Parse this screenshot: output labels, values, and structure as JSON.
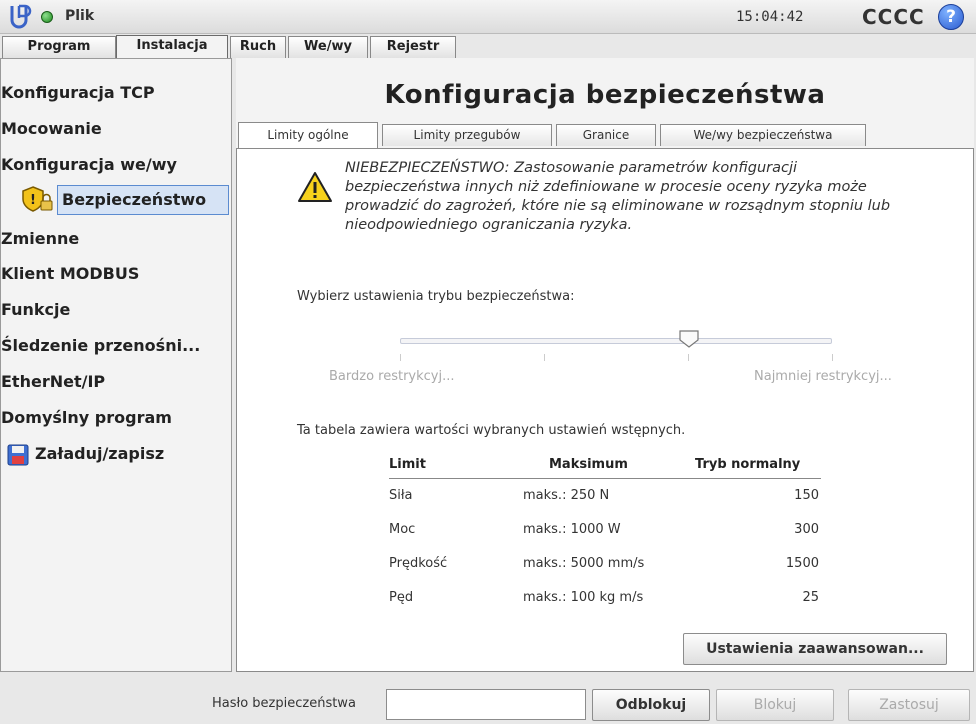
{
  "header": {
    "file_menu": "Plik",
    "clock": "15:04:42",
    "robot_name": "CCCC",
    "help": "?"
  },
  "main_tabs": [
    {
      "label": "Program"
    },
    {
      "label": "Instalacja",
      "active": true
    },
    {
      "label": "Ruch"
    },
    {
      "label": "We/wy"
    },
    {
      "label": "Rejestr"
    }
  ],
  "sidebar": {
    "items": [
      {
        "label": "Konfiguracja TCP"
      },
      {
        "label": "Mocowanie"
      },
      {
        "label": "Konfiguracja we/wy"
      },
      {
        "label": "Bezpieczeństwo",
        "selected": true
      },
      {
        "label": "Zmienne"
      },
      {
        "label": "Klient MODBUS"
      },
      {
        "label": "Funkcje"
      },
      {
        "label": "Śledzenie przenośni..."
      },
      {
        "label": "EtherNet/IP"
      },
      {
        "label": "Domyślny program"
      },
      {
        "label": "Załaduj/zapisz"
      }
    ]
  },
  "content": {
    "title": "Konfiguracja bezpieczeństwa",
    "sub_tabs": [
      {
        "label": "Limity ogólne",
        "active": true
      },
      {
        "label": "Limity przegubów"
      },
      {
        "label": "Granice"
      },
      {
        "label": "We/wy bezpieczeństwa"
      }
    ],
    "warning": "NIEBEZPIECZEŃSTWO: Zastosowanie parametrów konfiguracji bezpieczeństwa innych niż zdefiniowane w procesie oceny ryzyka może prowadzić do zagrożeń, które nie są eliminowane w rozsądnym stopniu lub nieodpowiedniego ograniczania ryzyka.",
    "mode_label": "Wybierz ustawienia trybu bezpieczeństwa:",
    "slider": {
      "min_label": "Bardzo restrykcyj...",
      "max_label": "Najmniej restrykcyj...",
      "position": 0.67
    },
    "table_intro": "Ta tabela zawiera wartości wybranych ustawień wstępnych.",
    "table": {
      "headers": [
        "Limit",
        "Maksimum",
        "Tryb normalny"
      ],
      "rows": [
        [
          "Siła",
          "maks.: 250 N",
          "150"
        ],
        [
          "Moc",
          "maks.: 1000 W",
          "300"
        ],
        [
          "Prędkość",
          "maks.: 5000 mm/s",
          "1500"
        ],
        [
          "Pęd",
          "maks.: 100 kg m/s",
          "25"
        ]
      ]
    },
    "advanced_button": "Ustawienia zaawansowan..."
  },
  "footer": {
    "password_label": "Hasło bezpieczeństwa",
    "password_value": "",
    "unlock_button": "Odblokuj",
    "lock_button": "Blokuj",
    "apply_button": "Zastosuj"
  },
  "colors": {
    "selection_bg": "#d6e3f5",
    "selection_border": "#5b8bd0",
    "warning_yellow": "#f7d21c",
    "status_green": "#2aa02a",
    "help_blue": "#2a5bd0"
  }
}
